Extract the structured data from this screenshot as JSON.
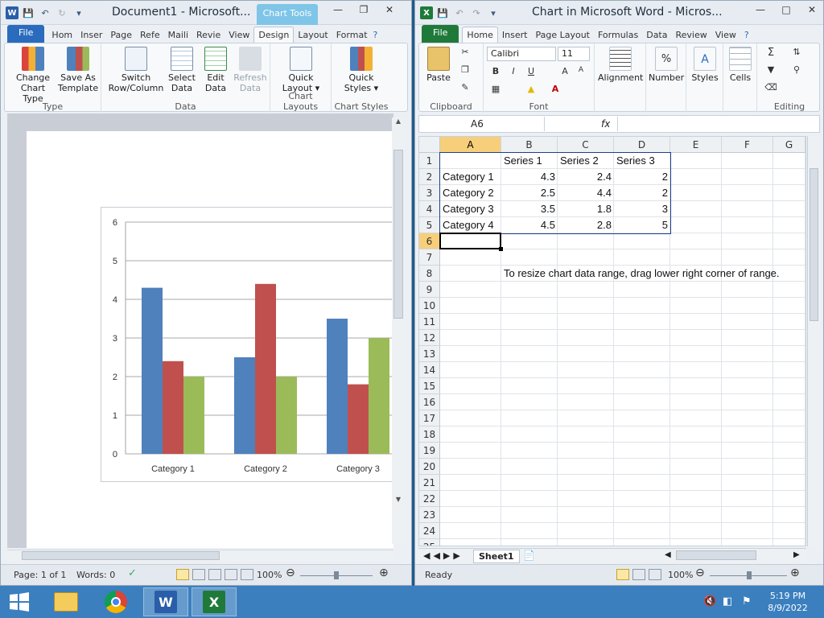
{
  "word": {
    "title": "Document1 - Microsoft...",
    "context_tab": "Chart Tools",
    "tabs": [
      "File",
      "Hom",
      "Inser",
      "Page",
      "Refe",
      "Maili",
      "Revie",
      "View",
      "Design",
      "Layout",
      "Format"
    ],
    "ribbon": {
      "groups": [
        "Type",
        "Data",
        "Chart Layouts",
        "Chart Styles"
      ],
      "buttons": {
        "change_chart_type": "Change\nChart Type",
        "save_as_template": "Save As\nTemplate",
        "switch_row_col": "Switch\nRow/Column",
        "select_data": "Select\nData",
        "edit_data": "Edit\nData",
        "refresh_data": "Refresh\nData",
        "quick_layout": "Quick\nLayout ▾",
        "quick_styles": "Quick\nStyles ▾"
      }
    },
    "status": {
      "page": "Page: 1 of 1",
      "words": "Words: 0",
      "zoom": "100%"
    }
  },
  "chart_data": {
    "type": "bar",
    "categories": [
      "Category 1",
      "Category 2",
      "Category 3",
      "Category 4"
    ],
    "series": [
      {
        "name": "Series 1",
        "values": [
          4.3,
          2.5,
          3.5,
          4.5
        ],
        "color": "#4f81bd"
      },
      {
        "name": "Series 2",
        "values": [
          2.4,
          4.4,
          1.8,
          2.8
        ],
        "color": "#c0504d"
      },
      {
        "name": "Series 3",
        "values": [
          2,
          2,
          3,
          5
        ],
        "color": "#9bbb59"
      }
    ],
    "ylim": [
      0,
      6
    ],
    "yticks": [
      "0",
      "1",
      "2",
      "3",
      "4",
      "5",
      "6"
    ],
    "grid": true,
    "visible_categories": 3
  },
  "excel": {
    "title": "Chart in Microsoft Word - Micros...",
    "tabs": [
      "File",
      "Home",
      "Insert",
      "Page Layout",
      "Formulas",
      "Data",
      "Review",
      "View"
    ],
    "font": {
      "name": "Calibri",
      "size": "11"
    },
    "ribbon_groups": [
      "Clipboard",
      "Font",
      "Alignment",
      "Number",
      "Styles",
      "Cells",
      "Editing"
    ],
    "paste_label": "Paste",
    "alignment_label": "Alignment",
    "number_label": "Number",
    "styles_label": "Styles",
    "cells_label": "Cells",
    "namebox": "A6",
    "fx": "fx",
    "columns": [
      "A",
      "B",
      "C",
      "D",
      "E",
      "F",
      "G"
    ],
    "rows": [
      "1",
      "2",
      "3",
      "4",
      "5",
      "6",
      "7",
      "8",
      "9",
      "10",
      "11",
      "12",
      "13",
      "14",
      "15",
      "16",
      "17",
      "18",
      "19",
      "20",
      "21",
      "22",
      "23",
      "24",
      "25"
    ],
    "headers": [
      "Series 1",
      "Series 2",
      "Series 3"
    ],
    "data": [
      {
        "label": "Category 1",
        "v1": "4.3",
        "v2": "2.4",
        "v3": "2"
      },
      {
        "label": "Category 2",
        "v1": "2.5",
        "v2": "4.4",
        "v3": "2"
      },
      {
        "label": "Category 3",
        "v1": "3.5",
        "v2": "1.8",
        "v3": "3"
      },
      {
        "label": "Category 4",
        "v1": "4.5",
        "v2": "2.8",
        "v3": "5"
      }
    ],
    "note": "To resize chart data range, drag lower right corner of range.",
    "sheet_tab": "Sheet1",
    "status": {
      "ready": "Ready",
      "zoom": "100%"
    }
  },
  "taskbar": {
    "time": "5:19 PM",
    "date": "8/9/2022"
  }
}
